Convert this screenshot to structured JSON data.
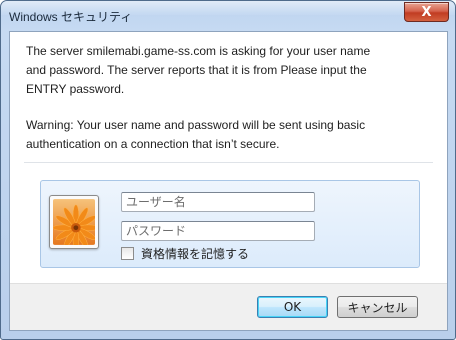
{
  "window": {
    "title": "Windows セキュリティ",
    "close_label": "X"
  },
  "message": {
    "line1": "The server smilemabi.game-ss.com is asking for your user name",
    "line2": "and password. The server reports that it is from Please input the",
    "line3": "ENTRY password.",
    "warning_line1": "Warning: Your user name and password will be sent using basic",
    "warning_line2": "authentication on a connection that isn’t secure."
  },
  "credentials": {
    "username_placeholder": "ユーザー名",
    "username_value": "",
    "password_placeholder": "パスワード",
    "password_value": "",
    "remember_label": "資格情報を記憶する",
    "remember_checked": false,
    "avatar_icon": "flower-user-tile-icon"
  },
  "buttons": {
    "ok": "OK",
    "cancel": "キャンセル"
  }
}
